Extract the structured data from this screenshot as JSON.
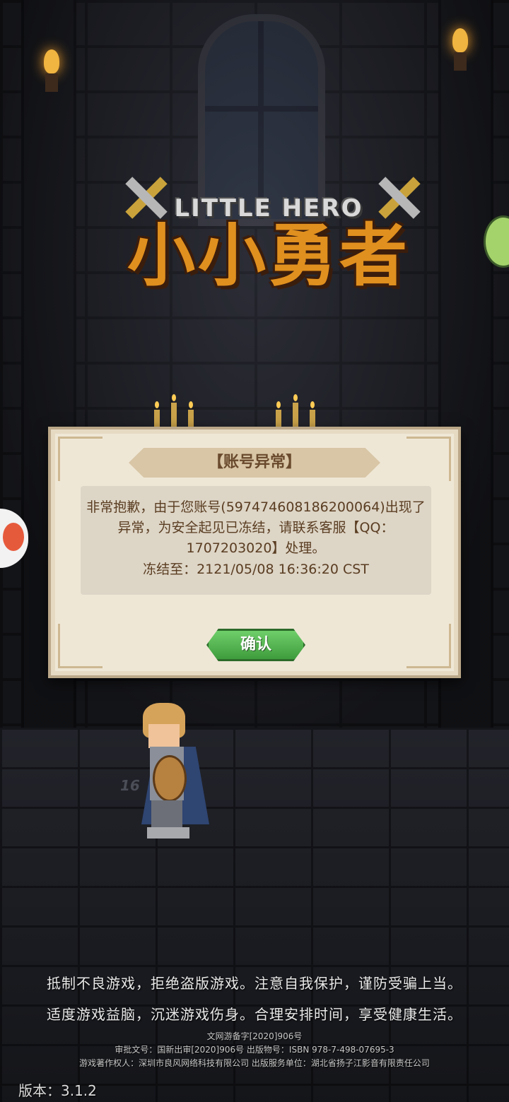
{
  "game": {
    "logo_en": "LITTLE HERO",
    "logo_cn": "小小勇者",
    "hero_level": "16"
  },
  "dialog": {
    "title": "【账号异常】",
    "message": "非常抱歉，由于您账号(597474608186200064)出现了异常，为安全起见已冻结，请联系客服【QQ：1707203020】处理。",
    "freeze_until": "冻结至：2121/05/08 16:36:20 CST",
    "confirm_label": "确认"
  },
  "footer": {
    "notice_1": "抵制不良游戏，拒绝盗版游戏。注意自我保护，谨防受骗上当。",
    "notice_2": "适度游戏益脑，沉迷游戏伤身。合理安排时间，享受健康生活。",
    "record": "文网游备字[2020]906号",
    "approval": "审批文号：国新出审[2020]906号  出版物号：ISBN 978-7-498-07695-3",
    "copyright": "游戏著作权人：深圳市良风网络科技有限公司  出版服务单位：湖北省扬子江影音有限责任公司",
    "version": "版本：3.1.2"
  },
  "colors": {
    "dialog_bg": "#efe7d6",
    "dialog_text": "#5a3d22",
    "confirm_green": "#4fb04a",
    "logo_orange": "#e0901f"
  },
  "icons": [
    "torch-icon",
    "sword-icon",
    "side-menu-icon",
    "slime-icon"
  ]
}
